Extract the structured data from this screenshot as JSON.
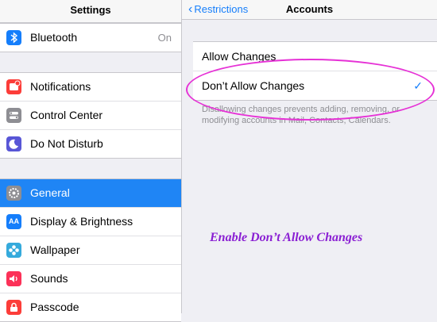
{
  "sidebar": {
    "title": "Settings",
    "bluetooth": {
      "label": "Bluetooth",
      "value": "On",
      "icon": "bluetooth-icon",
      "color": "#157efb"
    },
    "notifications": {
      "label": "Notifications",
      "icon": "notifications-icon",
      "color": "#fc3d39"
    },
    "control_center": {
      "label": "Control Center",
      "icon": "control-center-icon",
      "color": "#8e8e93"
    },
    "do_not_disturb": {
      "label": "Do Not Disturb",
      "icon": "moon-icon",
      "color": "#5856d6"
    },
    "general": {
      "label": "General",
      "icon": "gear-icon",
      "color": "#8e8e93"
    },
    "display": {
      "label": "Display & Brightness",
      "icon": "display-icon",
      "glyph": "AA",
      "color": "#157efb"
    },
    "wallpaper": {
      "label": "Wallpaper",
      "icon": "wallpaper-icon",
      "color": "#35aadc"
    },
    "sounds": {
      "label": "Sounds",
      "icon": "sounds-icon",
      "color": "#fc3158"
    },
    "passcode": {
      "label": "Passcode",
      "icon": "lock-icon",
      "color": "#fc3d39"
    }
  },
  "nav": {
    "back_label": "Restrictions",
    "title": "Accounts"
  },
  "options": {
    "allow": "Allow Changes",
    "dont_allow": "Don’t Allow Changes"
  },
  "footnote": "Disallowing changes prevents adding, removing, or modifying accounts in Mail, Contacts, Calendars.",
  "annotation": "Enable Don’t Allow Changes"
}
